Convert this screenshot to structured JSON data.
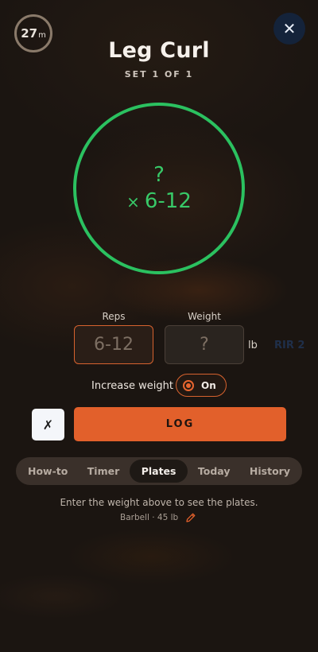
{
  "timer": {
    "value": "27",
    "unit": "m"
  },
  "exercise": {
    "title": "Leg Curl",
    "subtitle": "SET 1 OF 1"
  },
  "target": {
    "weight": "?",
    "reps_prefix": "×",
    "reps": "6-12"
  },
  "inputs": {
    "reps_label": "Reps",
    "reps_placeholder": "6-12",
    "weight_label": "Weight",
    "weight_placeholder": "?",
    "weight_unit": "lb",
    "rir": "RIR 2"
  },
  "increase_weight": {
    "label": "Increase weight",
    "state": "On"
  },
  "actions": {
    "skip_label": "✗",
    "log_label": "LOG"
  },
  "tabs": [
    {
      "label": "How-to",
      "active": false
    },
    {
      "label": "Timer",
      "active": false
    },
    {
      "label": "Plates",
      "active": true
    },
    {
      "label": "Today",
      "active": false
    },
    {
      "label": "History",
      "active": false
    }
  ],
  "plates": {
    "hint": "Enter the weight above to see the plates.",
    "barbell": "Barbell · 45 lb"
  },
  "colors": {
    "accent": "#e2602b",
    "ring": "#2bc160",
    "close_bg": "#14233a"
  },
  "icons": {
    "close": "close-icon",
    "edit": "pencil-icon",
    "radio": "radio-dot-icon"
  }
}
